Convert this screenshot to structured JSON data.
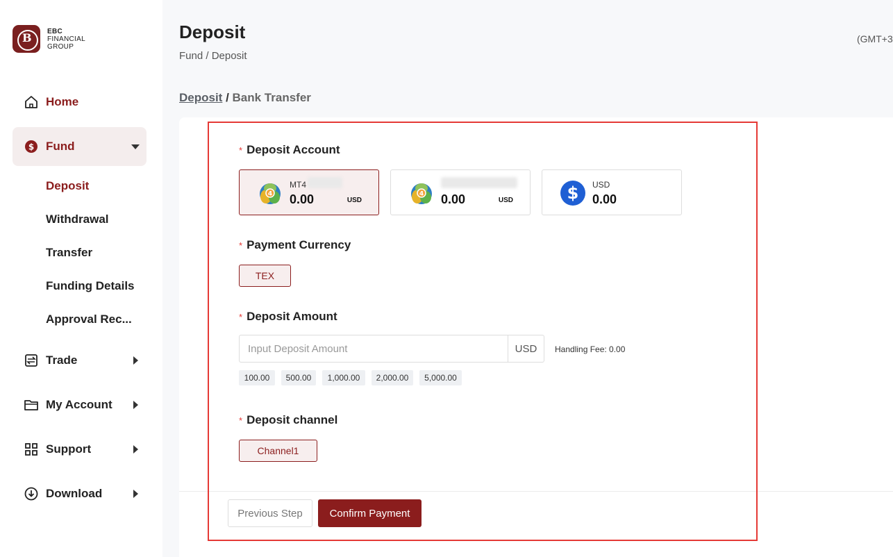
{
  "brand": {
    "line1": "EBC",
    "line2": "FINANCIAL",
    "line3": "GROUP"
  },
  "sidebar": {
    "home": "Home",
    "fund": "Fund",
    "fund_items": [
      "Deposit",
      "Withdrawal",
      "Transfer",
      "Funding Details",
      "Approval Rec..."
    ],
    "trade": "Trade",
    "my_account": "My Account",
    "support": "Support",
    "download": "Download"
  },
  "header": {
    "title": "Deposit",
    "breadcrumb": "Fund / Deposit",
    "timezone": "(GMT+3"
  },
  "sub_breadcrumb": {
    "link": "Deposit",
    "separator": " / ",
    "current": "Bank Transfer"
  },
  "form": {
    "deposit_account_label": "Deposit Account",
    "accounts": [
      {
        "name": "MT4",
        "amount": "0.00",
        "currency": "USD",
        "selected": true,
        "icon": "mt4-icon"
      },
      {
        "name": "",
        "amount": "0.00",
        "currency": "USD",
        "selected": false,
        "icon": "mt4-icon"
      },
      {
        "name": "USD",
        "amount": "0.00",
        "currency": "",
        "selected": false,
        "icon": "dollar-icon"
      }
    ],
    "payment_currency_label": "Payment Currency",
    "payment_currency": "TEX",
    "deposit_amount_label": "Deposit Amount",
    "amount_placeholder": "Input Deposit Amount",
    "amount_suffix": "USD",
    "handling_fee": "Handling Fee: 0.00",
    "quick_amounts": [
      "100.00",
      "500.00",
      "1,000.00",
      "2,000.00",
      "5,000.00"
    ],
    "deposit_channel_label": "Deposit channel",
    "channel": "Channel1"
  },
  "actions": {
    "previous": "Previous Step",
    "confirm": "Confirm Payment"
  },
  "colors": {
    "brand": "#8b1d1d",
    "highlight": "#e53935",
    "usd_coin": "#1f5fd4"
  }
}
